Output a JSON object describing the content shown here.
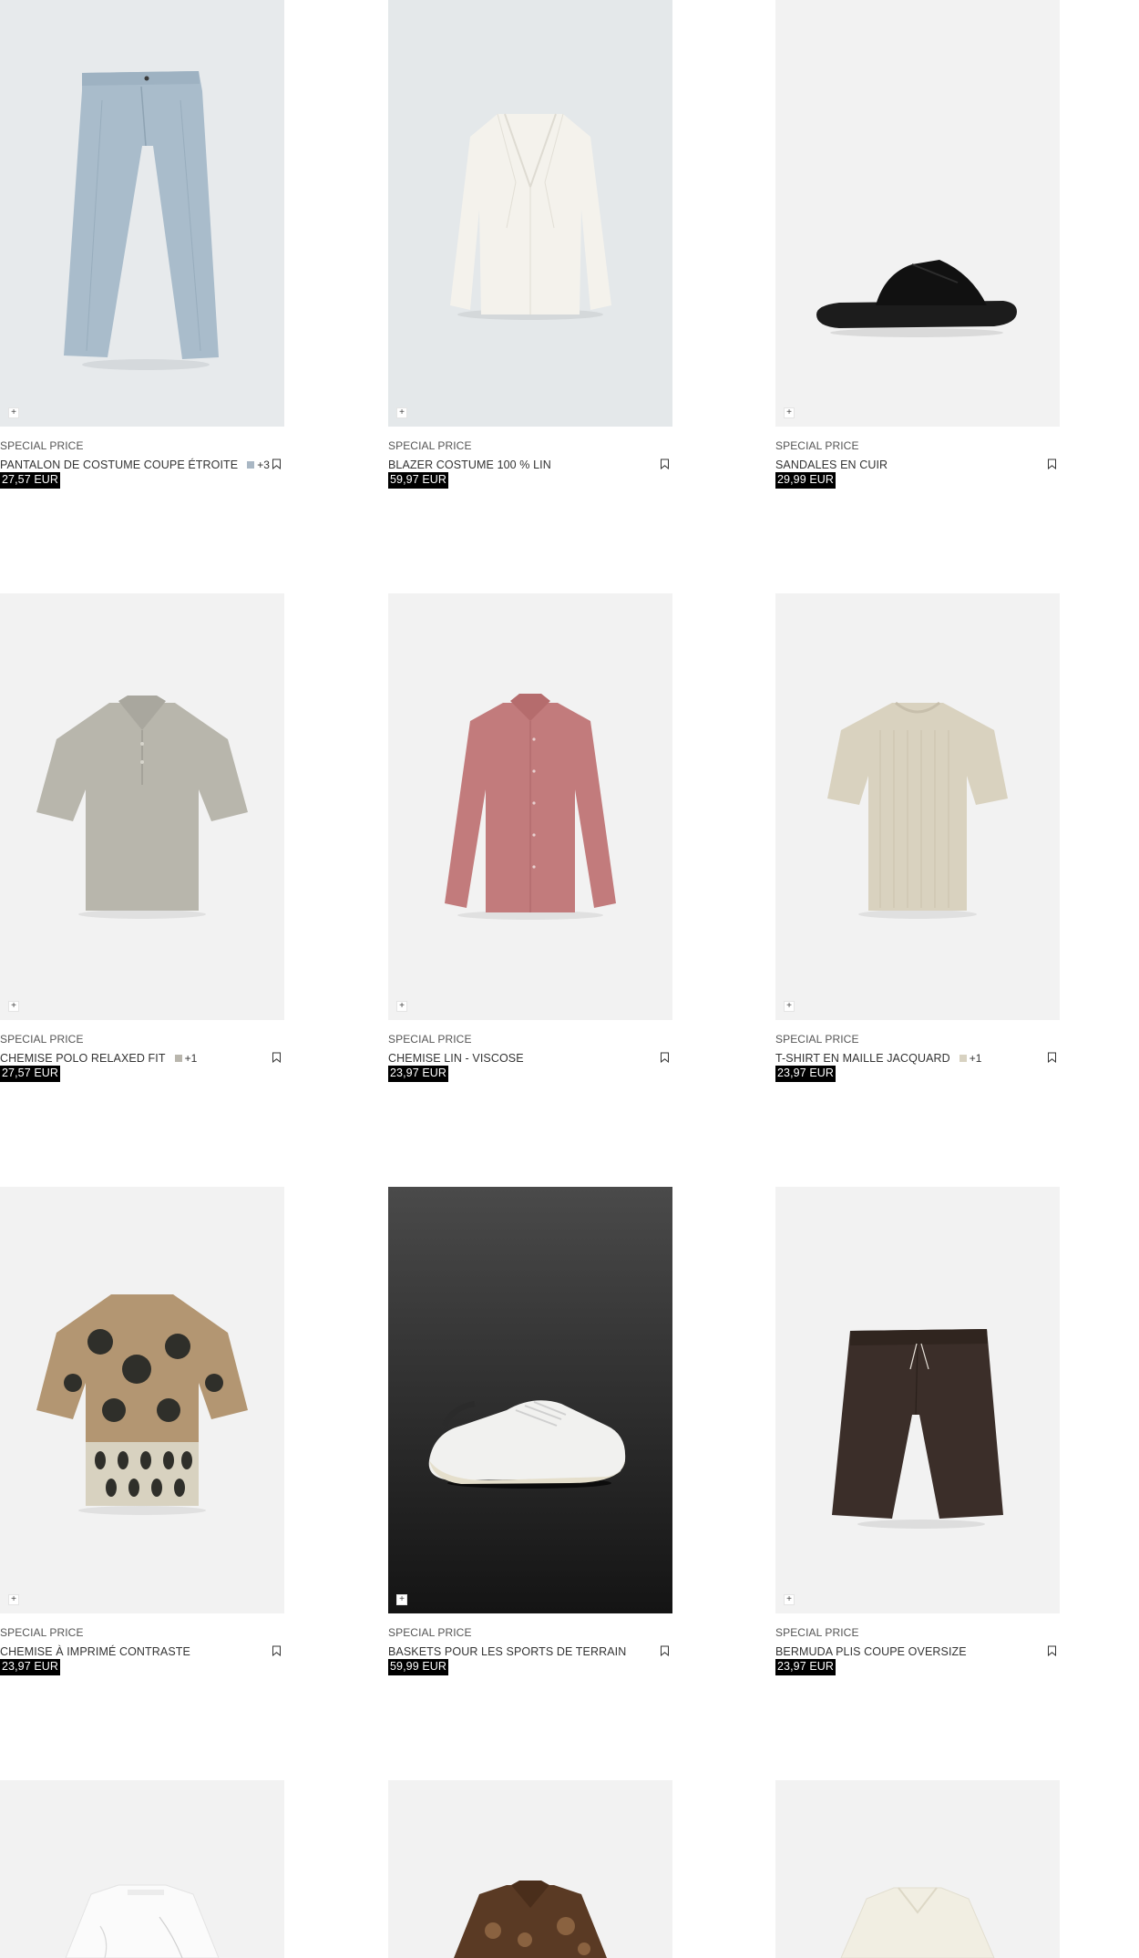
{
  "products": [
    {
      "badge": "SPECIAL PRICE",
      "name": "PANTALON DE COSTUME COUPE ÉTROITE",
      "swatch": "#a9b7c4",
      "more": "+3",
      "price": "27,57 EUR",
      "bg": "#e7eaec",
      "icon": "plus-icon"
    },
    {
      "badge": "SPECIAL PRICE",
      "name": "BLAZER COSTUME 100 % LIN",
      "price": "59,97 EUR",
      "bg": "#e4e8ea",
      "icon": "plus-icon"
    },
    {
      "badge": "SPECIAL PRICE",
      "name": "SANDALES EN CUIR",
      "price": "29,99 EUR",
      "bg": "#f2f2f2",
      "icon": "plus-icon"
    },
    {
      "badge": "SPECIAL PRICE",
      "name": "CHEMISE POLO RELAXED FIT",
      "swatch": "#b9b6ad",
      "more": "+1",
      "price": "27,57 EUR",
      "bg": "#f2f2f2",
      "icon": "plus-icon"
    },
    {
      "badge": "SPECIAL PRICE",
      "name": "CHEMISE LIN - VISCOSE",
      "price": "23,97 EUR",
      "bg": "#f2f2f2",
      "icon": "plus-icon"
    },
    {
      "badge": "SPECIAL PRICE",
      "name": "T-SHIRT EN MAILLE JACQUARD",
      "swatch": "#d8d2c1",
      "more": "+1",
      "price": "23,97 EUR",
      "bg": "#f2f2f2",
      "icon": "plus-icon"
    },
    {
      "badge": "SPECIAL PRICE",
      "name": "CHEMISE À IMPRIMÉ CONTRASTE",
      "price": "23,97 EUR",
      "bg": "#f2f2f2",
      "icon": "plus-icon"
    },
    {
      "badge": "SPECIAL PRICE",
      "name": "BASKETS POUR LES SPORTS DE TERRAIN",
      "price": "59,99 EUR",
      "bg": "#2a2a2a",
      "icon": "plus-icon"
    },
    {
      "badge": "SPECIAL PRICE",
      "name": "BERMUDA PLIS COUPE OVERSIZE",
      "price": "23,97 EUR",
      "bg": "#f2f2f2",
      "icon": "plus-icon"
    },
    {
      "bg": "#f2f2f2"
    },
    {
      "bg": "#f2f2f2"
    },
    {
      "bg": "#f2f2f2"
    }
  ],
  "icons": {
    "add": "plus-icon",
    "save": "bookmark-icon"
  },
  "add_glyph": "+"
}
